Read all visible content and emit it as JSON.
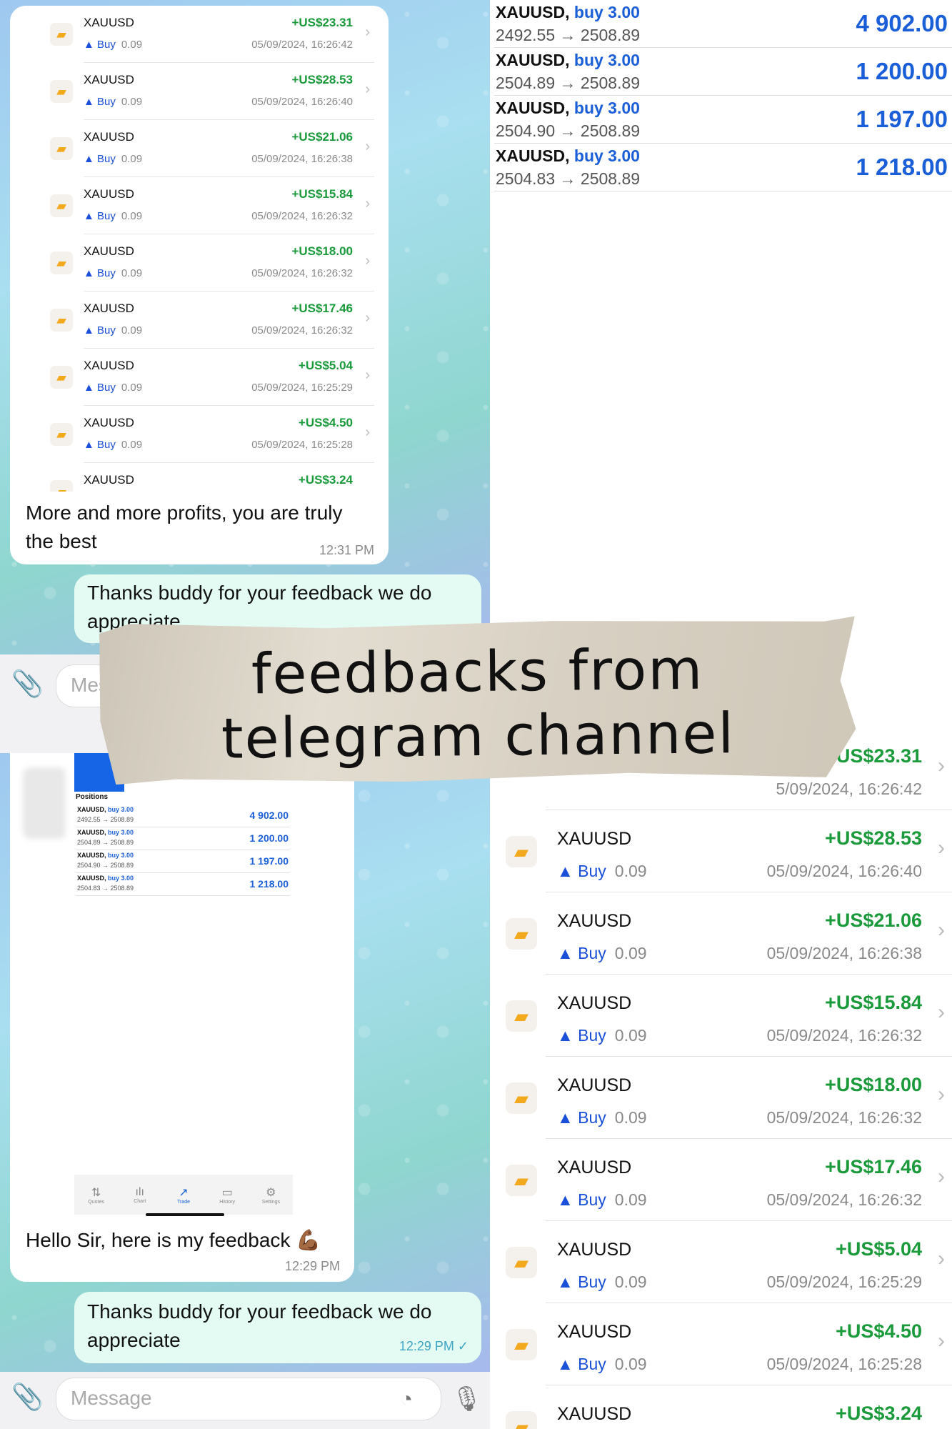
{
  "trades_small": [
    {
      "symbol": "XAUUSD",
      "side": "Buy",
      "volume": "0.09",
      "profit": "+US$23.31",
      "time": "05/09/2024, 16:26:42"
    },
    {
      "symbol": "XAUUSD",
      "side": "Buy",
      "volume": "0.09",
      "profit": "+US$28.53",
      "time": "05/09/2024, 16:26:40"
    },
    {
      "symbol": "XAUUSD",
      "side": "Buy",
      "volume": "0.09",
      "profit": "+US$21.06",
      "time": "05/09/2024, 16:26:38"
    },
    {
      "symbol": "XAUUSD",
      "side": "Buy",
      "volume": "0.09",
      "profit": "+US$15.84",
      "time": "05/09/2024, 16:26:32"
    },
    {
      "symbol": "XAUUSD",
      "side": "Buy",
      "volume": "0.09",
      "profit": "+US$18.00",
      "time": "05/09/2024, 16:26:32"
    },
    {
      "symbol": "XAUUSD",
      "side": "Buy",
      "volume": "0.09",
      "profit": "+US$17.46",
      "time": "05/09/2024, 16:26:32"
    },
    {
      "symbol": "XAUUSD",
      "side": "Buy",
      "volume": "0.09",
      "profit": "+US$5.04",
      "time": "05/09/2024, 16:25:29"
    },
    {
      "symbol": "XAUUSD",
      "side": "Buy",
      "volume": "0.09",
      "profit": "+US$4.50",
      "time": "05/09/2024, 16:25:28"
    },
    {
      "symbol": "XAUUSD",
      "profit": "+US$3.24"
    }
  ],
  "chat1": {
    "incoming_text": "More and more profits, you are truly the best",
    "incoming_time": "12:31 PM",
    "outgoing_text": "Thanks buddy for your feedback we do appreciate",
    "input_placeholder": "Mes"
  },
  "chat2": {
    "incoming_text": "Hello Sir, here is my feedback 💪🏾",
    "incoming_time": "12:29 PM",
    "outgoing_text": "Thanks buddy for your feedback we do appreciate",
    "outgoing_time": "12:29 PM",
    "input_placeholder": "Message"
  },
  "positions_title": "Positions",
  "positions": [
    {
      "symbol": "XAUUSD,",
      "side": "buy 3.00",
      "prices": "2492.55 → 2508.89",
      "value": "4 902.00"
    },
    {
      "symbol": "XAUUSD,",
      "side": "buy 3.00",
      "prices": "2504.89 → 2508.89",
      "value": "1 200.00"
    },
    {
      "symbol": "XAUUSD,",
      "side": "buy 3.00",
      "prices": "2504.90 → 2508.89",
      "value": "1 197.00"
    },
    {
      "symbol": "XAUUSD,",
      "side": "buy 3.00",
      "prices": "2504.83 → 2508.89",
      "value": "1 218.00"
    }
  ],
  "mini_tabs": [
    "Quotes",
    "Chart",
    "Trade",
    "History",
    "Settings"
  ],
  "trades_big_first": {
    "profit": "+US$23.31",
    "time": "5/09/2024, 16:26:42"
  },
  "trades_big": [
    {
      "symbol": "XAUUSD",
      "side": "Buy",
      "volume": "0.09",
      "profit": "+US$28.53",
      "time": "05/09/2024, 16:26:40"
    },
    {
      "symbol": "XAUUSD",
      "side": "Buy",
      "volume": "0.09",
      "profit": "+US$21.06",
      "time": "05/09/2024, 16:26:38"
    },
    {
      "symbol": "XAUUSD",
      "side": "Buy",
      "volume": "0.09",
      "profit": "+US$15.84",
      "time": "05/09/2024, 16:26:32"
    },
    {
      "symbol": "XAUUSD",
      "side": "Buy",
      "volume": "0.09",
      "profit": "+US$18.00",
      "time": "05/09/2024, 16:26:32"
    },
    {
      "symbol": "XAUUSD",
      "side": "Buy",
      "volume": "0.09",
      "profit": "+US$17.46",
      "time": "05/09/2024, 16:26:32"
    },
    {
      "symbol": "XAUUSD",
      "side": "Buy",
      "volume": "0.09",
      "profit": "+US$5.04",
      "time": "05/09/2024, 16:25:29"
    },
    {
      "symbol": "XAUUSD",
      "side": "Buy",
      "volume": "0.09",
      "profit": "+US$4.50",
      "time": "05/09/2024, 16:25:28"
    },
    {
      "symbol": "XAUUSD",
      "profit": "+US$3.24"
    }
  ],
  "banner": {
    "line1": "feedbacks from",
    "line2": "telegram channel"
  }
}
